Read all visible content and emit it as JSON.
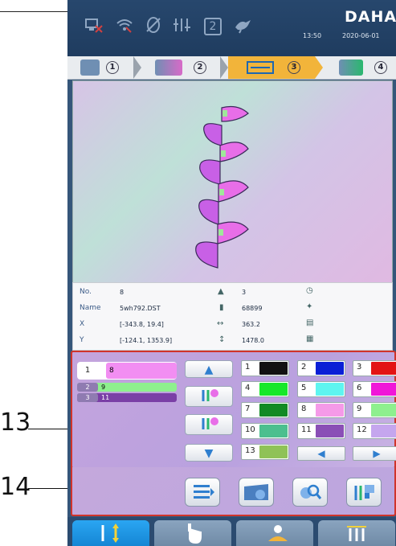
{
  "status": {
    "brand": "DAHAO",
    "time": "13:50",
    "date": "2020-06-01",
    "icons": [
      "network-icon",
      "wifi-icon",
      "usb-disabled-icon",
      "needle-tension-icon",
      "box-2-icon",
      "bird-icon"
    ],
    "box_value": "2"
  },
  "steps": [
    {
      "num": "1",
      "icon": "design-folder-icon"
    },
    {
      "num": "2",
      "icon": "design-edit-icon"
    },
    {
      "num": "3",
      "icon": "frame-size-icon",
      "active": true
    },
    {
      "num": "4",
      "icon": "embroider-icon"
    }
  ],
  "design_info": {
    "no_label": "No.",
    "no_value": "8",
    "name_label": "Name",
    "name_value": "5wh792.DST",
    "x_label": "X",
    "x_value": "[-343.8, 19.4]",
    "y_label": "Y",
    "y_value": "[-124.1, 1353.9]",
    "colors_value": "3",
    "stitches_value": "68899",
    "width_value": "363.2",
    "height_value": "1478.0"
  },
  "needle_list": [
    {
      "seq": "1",
      "needle": "8",
      "color": "#f28ef2"
    },
    {
      "seq": "2",
      "needle": "9",
      "color": "#8ef08e"
    },
    {
      "seq": "3",
      "needle": "11",
      "color": "#7a3fa6"
    }
  ],
  "palette": [
    {
      "n": "1",
      "color": "#111111"
    },
    {
      "n": "2",
      "color": "#0a1fd6"
    },
    {
      "n": "3",
      "color": "#e31414"
    },
    {
      "n": "4",
      "color": "#17e82a"
    },
    {
      "n": "5",
      "color": "#5ef5f0"
    },
    {
      "n": "6",
      "color": "#f016d8"
    },
    {
      "n": "7",
      "color": "#128a24"
    },
    {
      "n": "8",
      "color": "#f59ae8"
    },
    {
      "n": "9",
      "color": "#8ef08e"
    },
    {
      "n": "10",
      "color": "#4cbf8e"
    },
    {
      "n": "11",
      "color": "#8a4fb6"
    },
    {
      "n": "12",
      "color": "#c5a6ee"
    },
    {
      "n": "13",
      "color": "#8fc257"
    }
  ],
  "callouts": {
    "c13": "13",
    "c14": "14"
  },
  "bottom_tabs": [
    "needle-select-icon",
    "hand-touch-icon",
    "operator-icon",
    "needles-icon"
  ]
}
